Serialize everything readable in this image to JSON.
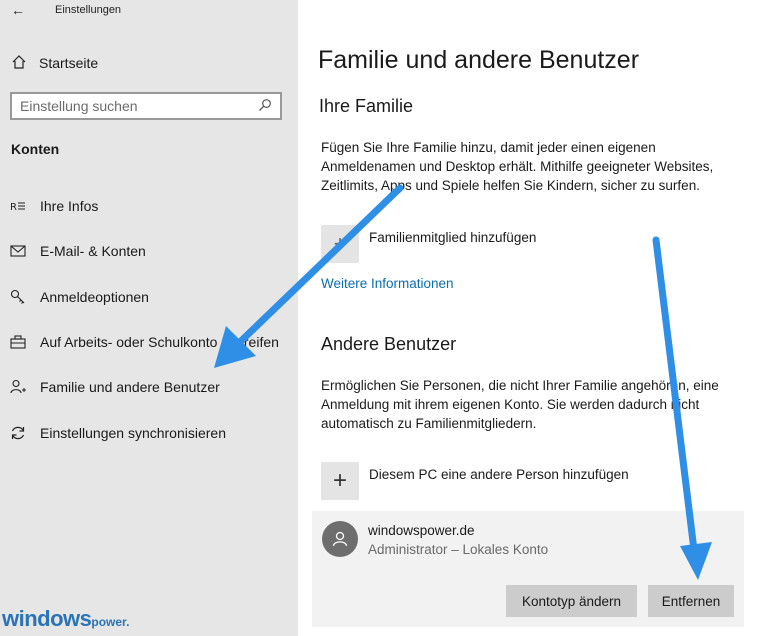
{
  "window": {
    "title": "Einstellungen"
  },
  "sidebar": {
    "home_label": "Startseite",
    "search_placeholder": "Einstellung suchen",
    "section_title": "Konten",
    "items": [
      {
        "icon": "person-card-icon",
        "label": "Ihre Infos"
      },
      {
        "icon": "mail-icon",
        "label": "E-Mail- & Konten"
      },
      {
        "icon": "key-icon",
        "label": "Anmeldeoptionen"
      },
      {
        "icon": "briefcase-icon",
        "label": "Auf Arbeits- oder Schulkonto zugreifen"
      },
      {
        "icon": "person-add-icon",
        "label": "Familie und andere Benutzer"
      },
      {
        "icon": "sync-icon",
        "label": "Einstellungen synchronisieren"
      }
    ]
  },
  "main": {
    "title": "Familie und andere Benutzer",
    "family": {
      "heading": "Ihre Familie",
      "description_lines": [
        "Fügen Sie Ihre Familie hinzu, damit jeder einen eigenen",
        "Anmeldenamen und Desktop erhält. Mithilfe geeigneter Websites,",
        "Zeitlimits, Apps und Spiele helfen Sie Kindern, sicher zu surfen."
      ],
      "add_label": "Familienmitglied hinzufügen",
      "more_info_link": "Weitere Informationen"
    },
    "other_users": {
      "heading": "Andere Benutzer",
      "description_lines": [
        "Ermöglichen Sie Personen, die nicht Ihrer Familie angehören, eine",
        "Anmeldung mit ihrem eigenen Konto. Sie werden dadurch nicht",
        "automatisch zu Familienmitgliedern."
      ],
      "add_label": "Diesem PC eine andere Person hinzufügen",
      "account": {
        "name": "windowspower.de",
        "type": "Administrator – Lokales Konto",
        "change_type_button": "Kontotyp ändern",
        "remove_button": "Entfernen"
      }
    }
  },
  "watermark": {
    "brand": "windows",
    "suffix": "power."
  },
  "colors": {
    "sidebar_bg": "#e6e6e6",
    "link": "#0a6cb5",
    "arrow": "#2f8fe6",
    "button_bg": "#cccccc"
  }
}
